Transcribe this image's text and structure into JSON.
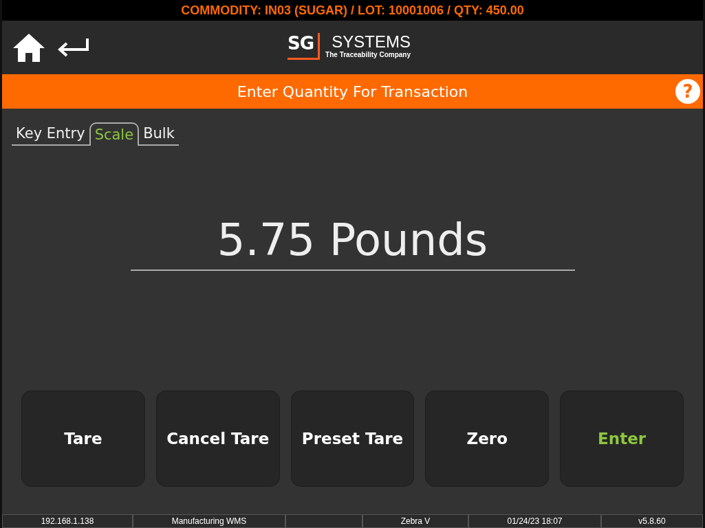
{
  "banner": "COMMODITY: IN03 (SUGAR) / LOT: 10001006 / QTY: 450.00",
  "logo": {
    "mark": "SG",
    "name": "SYSTEMS",
    "tagline": "The Traceability Company"
  },
  "title_bar": {
    "title": "Enter Quantity For Transaction",
    "help": "?"
  },
  "tabs": [
    {
      "label": "Key Entry",
      "selected": false
    },
    {
      "label": "Scale",
      "selected": true
    },
    {
      "label": "Bulk",
      "selected": false
    }
  ],
  "reading": "5.75 Pounds",
  "buttons": [
    {
      "label": "Tare",
      "kind": "normal"
    },
    {
      "label": "Cancel Tare",
      "kind": "normal"
    },
    {
      "label": "Preset Tare",
      "kind": "normal"
    },
    {
      "label": "Zero",
      "kind": "normal"
    },
    {
      "label": "Enter",
      "kind": "primary"
    }
  ],
  "status_bar": [
    {
      "kind": "text",
      "text": "192.168.1.138"
    },
    {
      "kind": "text",
      "text": "Manufacturing WMS"
    },
    {
      "kind": "empty"
    },
    {
      "kind": "text",
      "text": "Zebra V"
    },
    {
      "kind": "text",
      "text": "01/24/23 18:07"
    },
    {
      "kind": "text",
      "text": "v5.8.60"
    }
  ]
}
